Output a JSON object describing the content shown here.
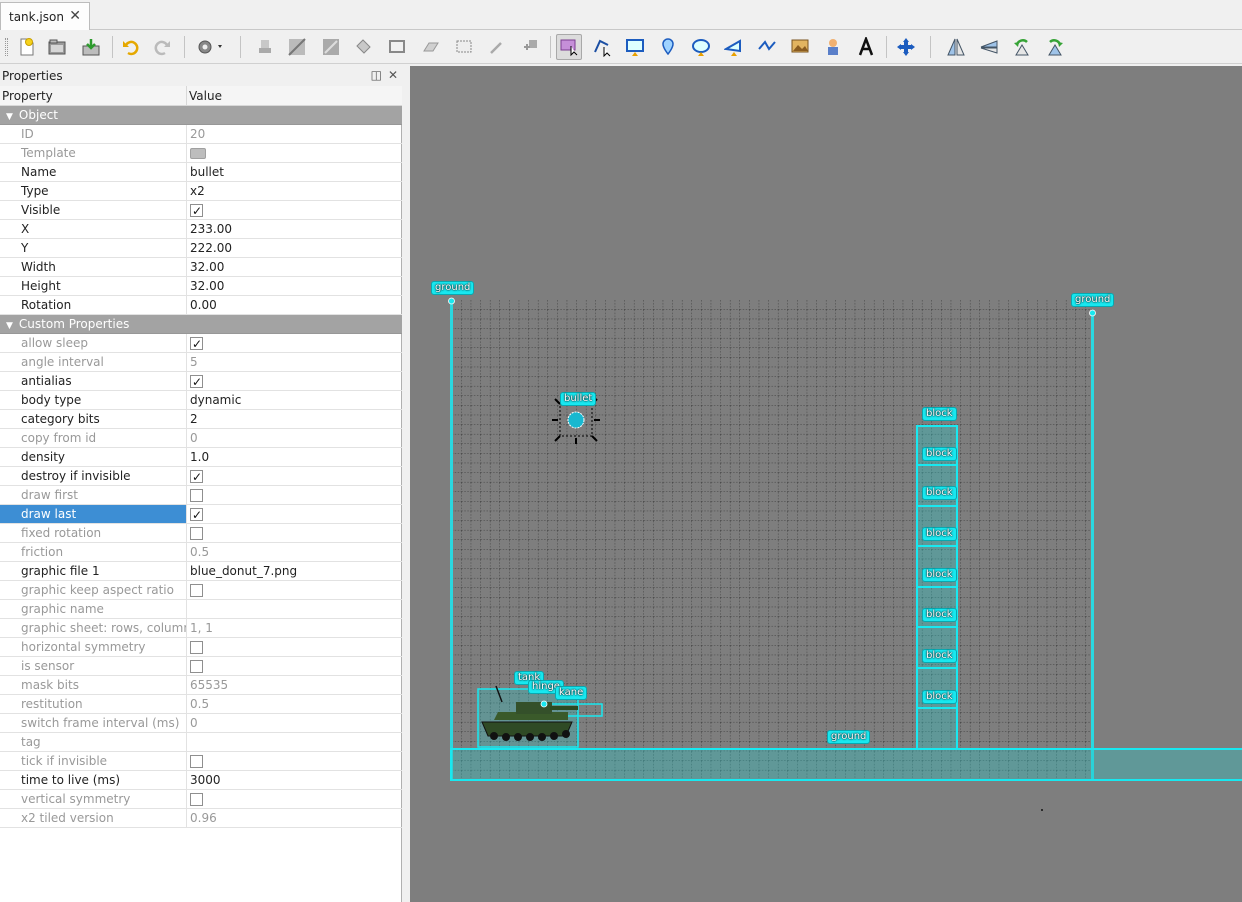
{
  "tab": {
    "title": "tank.json",
    "close": "✕"
  },
  "toolbar": {
    "buttons": [
      "new-file-icon",
      "open-file-icon",
      "save-file-icon",
      "undo-icon",
      "redo-icon",
      "settings-icon",
      "stamp-brush-icon",
      "terrain-brush-icon",
      "random-brush-icon",
      "bucket-fill-icon",
      "shape-fill-icon",
      "eraser-icon",
      "rect-select-icon",
      "magic-wand-icon",
      "select-same-tile-icon",
      "select-objects-icon",
      "edit-polygons-icon",
      "insert-rectangle-icon",
      "insert-point-icon",
      "insert-ellipse-icon",
      "insert-polygon-icon",
      "insert-polyline-icon",
      "insert-tile-icon",
      "insert-template-icon",
      "insert-text-icon",
      "move-icon",
      "flip-horizontal-icon",
      "flip-vertical-icon",
      "rotate-left-icon",
      "rotate-right-icon"
    ],
    "active": "select-objects-icon"
  },
  "properties": {
    "title": "Properties",
    "panel_buttons": {
      "float": "◫",
      "close": "✕"
    },
    "col_property": "Property",
    "col_value": "Value",
    "rows": [
      {
        "type": "group",
        "label": "Object"
      },
      {
        "label": "ID",
        "value": "20",
        "dim": true
      },
      {
        "label": "Template",
        "swatch": true,
        "dim": true
      },
      {
        "label": "Name",
        "value": "bullet"
      },
      {
        "label": "Type",
        "value": "x2"
      },
      {
        "label": "Visible",
        "checkbox": true,
        "checked": true
      },
      {
        "label": "X",
        "value": "233.00"
      },
      {
        "label": "Y",
        "value": "222.00"
      },
      {
        "label": "Width",
        "value": "32.00"
      },
      {
        "label": "Height",
        "value": "32.00"
      },
      {
        "label": "Rotation",
        "value": "0.00"
      },
      {
        "type": "group",
        "label": "Custom Properties"
      },
      {
        "label": "allow sleep",
        "checkbox": true,
        "checked": true,
        "dim": true
      },
      {
        "label": "angle interval",
        "value": "5",
        "dim": true
      },
      {
        "label": "antialias",
        "checkbox": true,
        "checked": true
      },
      {
        "label": "body type",
        "value": "dynamic"
      },
      {
        "label": "category bits",
        "value": "2"
      },
      {
        "label": "copy from id",
        "value": "0",
        "dim": true
      },
      {
        "label": "density",
        "value": "1.0"
      },
      {
        "label": "destroy if invisible",
        "checkbox": true,
        "checked": true
      },
      {
        "label": "draw first",
        "checkbox": true,
        "checked": false,
        "dim": true
      },
      {
        "label": "draw last",
        "checkbox": true,
        "checked": true,
        "selected": true
      },
      {
        "label": "fixed rotation",
        "checkbox": true,
        "checked": false,
        "dim": true
      },
      {
        "label": "friction",
        "value": "0.5",
        "dim": true
      },
      {
        "label": "graphic file 1",
        "value": "blue_donut_7.png"
      },
      {
        "label": "graphic keep aspect ratio",
        "checkbox": true,
        "checked": false,
        "dim": true
      },
      {
        "label": "graphic name",
        "value": "",
        "dim": true
      },
      {
        "label": "graphic sheet: rows, columns",
        "value": "1, 1",
        "dim": true
      },
      {
        "label": "horizontal symmetry",
        "checkbox": true,
        "checked": false,
        "dim": true
      },
      {
        "label": "is sensor",
        "checkbox": true,
        "checked": false,
        "dim": true
      },
      {
        "label": "mask bits",
        "value": "65535",
        "dim": true
      },
      {
        "label": "restitution",
        "value": "0.5",
        "dim": true
      },
      {
        "label": "switch frame interval (ms)",
        "value": "0",
        "dim": true
      },
      {
        "label": "tag",
        "value": "",
        "dim": true
      },
      {
        "label": "tick if invisible",
        "checkbox": true,
        "checked": false,
        "dim": true
      },
      {
        "label": "time to live (ms)",
        "value": "3000"
      },
      {
        "label": "vertical symmetry",
        "checkbox": true,
        "checked": false,
        "dim": true
      },
      {
        "label": "x2 tiled version",
        "value": "0.96",
        "dim": true
      }
    ]
  },
  "canvas": {
    "labels": {
      "ground_left": "ground",
      "ground_right": "ground",
      "ground_bottom": "ground",
      "bullet": "bullet",
      "tank": "tank",
      "hinge": "hinge",
      "kane": "kane",
      "block": "block"
    },
    "colors": {
      "accent": "#18e8f0",
      "background": "#7e7e7e",
      "selection": "#3d8ed4"
    }
  }
}
